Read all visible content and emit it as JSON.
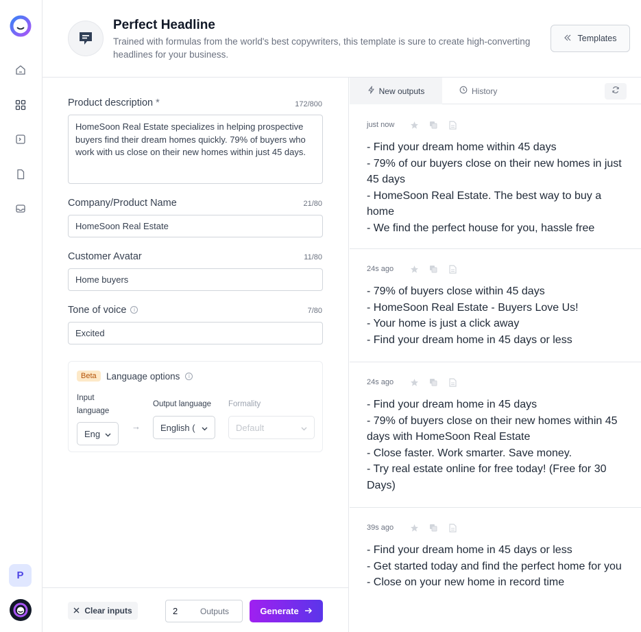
{
  "header": {
    "title": "Perfect Headline",
    "description": "Trained with formulas from the world's best copywriters, this template is sure to create high-converting headlines for your business.",
    "templates_label": "Templates"
  },
  "sidebar": {
    "items": [
      "home-icon",
      "grid-icon",
      "terminal-icon",
      "document-icon",
      "inbox-icon"
    ],
    "workspace_initial": "P"
  },
  "form": {
    "product_description": {
      "label": "Product description",
      "required_mark": "*",
      "count": "172/800",
      "value": "HomeSoon Real Estate specializes in helping prospective buyers find their dream homes quickly. 79% of buyers who work with us close on their new homes within just 45 days."
    },
    "company_name": {
      "label": "Company/Product Name",
      "count": "21/80",
      "value": "HomeSoon Real Estate"
    },
    "customer_avatar": {
      "label": "Customer Avatar",
      "count": "11/80",
      "value": "Home buyers"
    },
    "tone_of_voice": {
      "label": "Tone of voice",
      "count": "7/80",
      "value": "Excited"
    },
    "language": {
      "beta": "Beta",
      "title": "Language options",
      "input_label": "Input language",
      "input_value": "Eng",
      "output_label": "Output language",
      "output_value": "English (",
      "formality_label": "Formality",
      "formality_value": "Default",
      "arrow": "→"
    }
  },
  "footer": {
    "clear_label": "Clear inputs",
    "outputs_count": "2",
    "outputs_label": "Outputs",
    "generate_label": "Generate"
  },
  "outputs": {
    "tabs": {
      "new": "New outputs",
      "history": "History"
    },
    "cards": [
      {
        "time": "just now",
        "lines": [
          "- Find your dream home within 45 days",
          "- 79% of our buyers close on their new homes in just 45 days",
          "- HomeSoon Real Estate. The best way to buy a home",
          "- We find the perfect house for you, hassle free"
        ]
      },
      {
        "time": "24s ago",
        "lines": [
          "- 79% of buyers close within 45 days",
          "- HomeSoon Real Estate - Buyers Love Us!",
          "- Your home is just a click away",
          "- Find your dream home in 45 days or less"
        ]
      },
      {
        "time": "24s ago",
        "lines": [
          "- Find your dream home in 45 days",
          "- 79% of buyers close on their new homes within 45 days with HomeSoon Real Estate",
          "- Close faster. Work smarter. Save money.",
          "- Try real estate online for free today! (Free for 30 Days)"
        ]
      },
      {
        "time": "39s ago",
        "lines": [
          "- Find your dream home in 45 days or less",
          "- Get started today and find the perfect home for you",
          "- Close on your new home in record time"
        ]
      }
    ]
  },
  "colors": {
    "accent_start": "#a020f0",
    "accent_end": "#5b35ea",
    "beta_bg": "#fde9c8"
  }
}
